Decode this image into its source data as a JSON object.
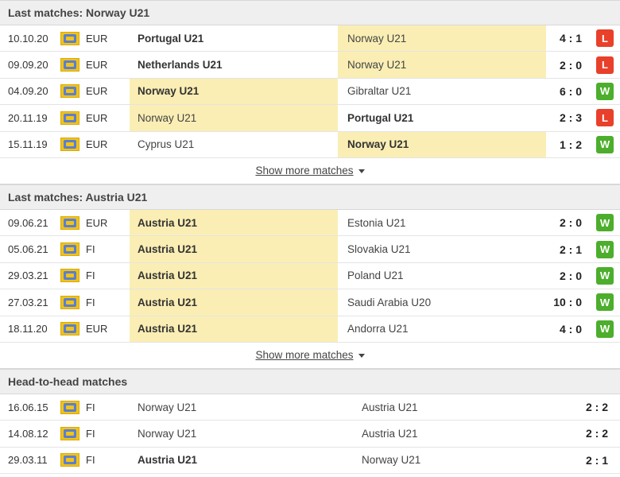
{
  "norway": {
    "title": "Last matches: Norway U21",
    "show_more": "Show more matches",
    "matches": [
      {
        "date": "10.10.20",
        "comp": "EUR",
        "home": "Portugal U21",
        "away": "Norway U21",
        "score": "4 : 1",
        "result": "L",
        "home_bold": true,
        "away_bold": false,
        "hl": "away"
      },
      {
        "date": "09.09.20",
        "comp": "EUR",
        "home": "Netherlands U21",
        "away": "Norway U21",
        "score": "2 : 0",
        "result": "L",
        "home_bold": true,
        "away_bold": false,
        "hl": "away"
      },
      {
        "date": "04.09.20",
        "comp": "EUR",
        "home": "Norway U21",
        "away": "Gibraltar U21",
        "score": "6 : 0",
        "result": "W",
        "home_bold": true,
        "away_bold": false,
        "hl": "home"
      },
      {
        "date": "20.11.19",
        "comp": "EUR",
        "home": "Norway U21",
        "away": "Portugal U21",
        "score": "2 : 3",
        "result": "L",
        "home_bold": false,
        "away_bold": true,
        "hl": "home"
      },
      {
        "date": "15.11.19",
        "comp": "EUR",
        "home": "Cyprus U21",
        "away": "Norway U21",
        "score": "1 : 2",
        "result": "W",
        "home_bold": false,
        "away_bold": true,
        "hl": "away"
      }
    ]
  },
  "austria": {
    "title": "Last matches: Austria U21",
    "show_more": "Show more matches",
    "matches": [
      {
        "date": "09.06.21",
        "comp": "EUR",
        "home": "Austria U21",
        "away": "Estonia U21",
        "score": "2 : 0",
        "result": "W",
        "home_bold": true,
        "away_bold": false,
        "hl": "home"
      },
      {
        "date": "05.06.21",
        "comp": "FI",
        "home": "Austria U21",
        "away": "Slovakia U21",
        "score": "2 : 1",
        "result": "W",
        "home_bold": true,
        "away_bold": false,
        "hl": "home"
      },
      {
        "date": "29.03.21",
        "comp": "FI",
        "home": "Austria U21",
        "away": "Poland U21",
        "score": "2 : 0",
        "result": "W",
        "home_bold": true,
        "away_bold": false,
        "hl": "home"
      },
      {
        "date": "27.03.21",
        "comp": "FI",
        "home": "Austria U21",
        "away": "Saudi Arabia U20",
        "score": "10 : 0",
        "result": "W",
        "home_bold": true,
        "away_bold": false,
        "hl": "home"
      },
      {
        "date": "18.11.20",
        "comp": "EUR",
        "home": "Austria U21",
        "away": "Andorra U21",
        "score": "4 : 0",
        "result": "W",
        "home_bold": true,
        "away_bold": false,
        "hl": "home"
      }
    ]
  },
  "h2h": {
    "title": "Head-to-head matches",
    "matches": [
      {
        "date": "16.06.15",
        "comp": "FI",
        "home": "Norway U21",
        "away": "Austria U21",
        "score": "2 : 2",
        "home_bold": false,
        "away_bold": false
      },
      {
        "date": "14.08.12",
        "comp": "FI",
        "home": "Norway U21",
        "away": "Austria U21",
        "score": "2 : 2",
        "home_bold": false,
        "away_bold": false
      },
      {
        "date": "29.03.11",
        "comp": "FI",
        "home": "Austria U21",
        "away": "Norway U21",
        "score": "2 : 1",
        "home_bold": true,
        "away_bold": false
      }
    ]
  },
  "colors": {
    "highlight": "#faeeb4",
    "win": "#4cae2c",
    "loss": "#e8402a"
  }
}
